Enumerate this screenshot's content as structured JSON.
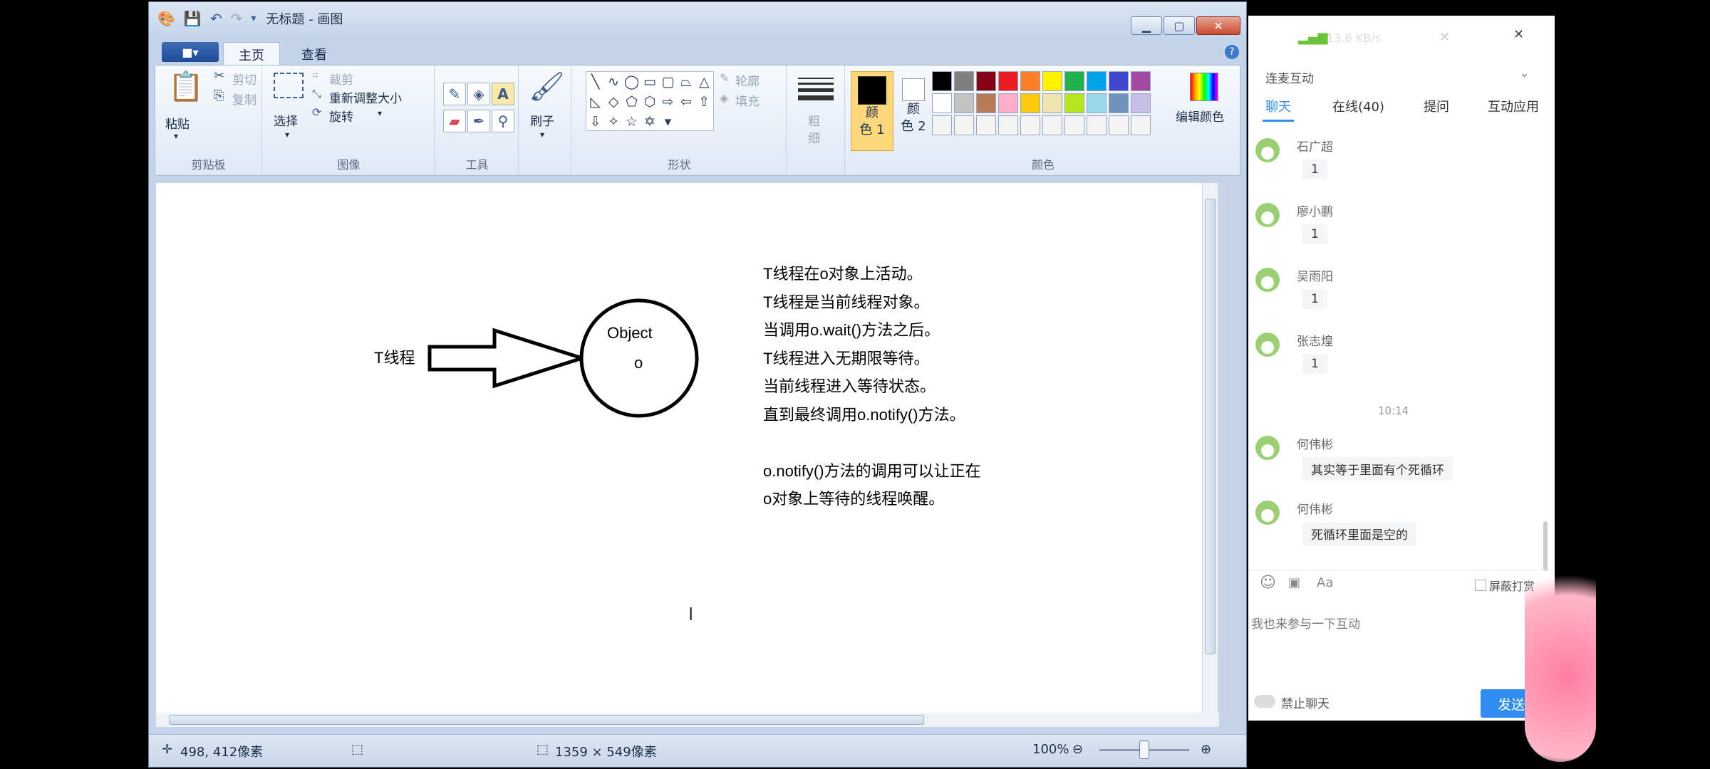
{
  "paint": {
    "window_title": "无标题 - 画图",
    "file_menu_icon": "■▾",
    "tabs": [
      "主页",
      "查看"
    ],
    "ribbon": {
      "clipboard": {
        "label": "剪贴板",
        "paste": "粘贴",
        "cut": "剪切",
        "copy": "复制"
      },
      "image": {
        "label": "图像",
        "select": "选择",
        "crop": "裁剪",
        "resize": "重新调整大小",
        "rotate": "旋转"
      },
      "tools": {
        "label": "工具"
      },
      "brushes": {
        "label": "刷子"
      },
      "shapes": {
        "label": "形状",
        "outline": "轮廓",
        "fill": "填充"
      },
      "size": {
        "label1": "粗",
        "label2": "细"
      },
      "colors": {
        "label": "颜色",
        "color1_a": "颜",
        "color1_b": "色 1",
        "color2_a": "颜",
        "color2_b": "色 2",
        "edit_colors": "编辑颜色",
        "color1": "#000000",
        "color2": "#ffffff"
      },
      "palette": [
        "#000000",
        "#7f7f7f",
        "#880015",
        "#ed1c24",
        "#ff7f27",
        "#fff200",
        "#22b14c",
        "#00a2e8",
        "#3f48cc",
        "#a349a4",
        "#ffffff",
        "#c3c3c3",
        "#b97a57",
        "#ffaec9",
        "#ffc90e",
        "#efe4b0",
        "#b5e61d",
        "#99d9ea",
        "#7092be",
        "#c8bfe7",
        "#f4f4f4",
        "#f4f4f4",
        "#f4f4f4",
        "#f4f4f4",
        "#f4f4f4",
        "#f4f4f4",
        "#f4f4f4",
        "#f4f4f4",
        "#f4f4f4",
        "#f4f4f4"
      ]
    },
    "canvas": {
      "arrow_label": "T线程",
      "circle_line1": "Object",
      "circle_line2": "o",
      "notes": [
        "T线程在o对象上活动。",
        "T线程是当前线程对象。",
        "当调用o.wait()方法之后。",
        "T线程进入无期限等待。",
        "当前线程进入等待状态。",
        "直到最终调用o.notify()方法。",
        "",
        "o.notify()方法的调用可以让正在",
        "o对象上等待的线程唤醒。"
      ]
    },
    "status": {
      "cursor_pos": "498, 412像素",
      "canvas_size": "1359 × 549像素",
      "zoom": "100%"
    }
  },
  "chat": {
    "net_speed": "13.6 KB/s",
    "section_title": "连麦互动",
    "tabs": [
      "聊天",
      "在线(40)",
      "提问",
      "互动应用"
    ],
    "messages": [
      {
        "user": "石广超",
        "text": "1"
      },
      {
        "user": "廖小鹏",
        "text": "1"
      },
      {
        "user": "吴雨阳",
        "text": "1"
      },
      {
        "user": "张志煌",
        "text": "1"
      }
    ],
    "time": "10:14",
    "messages2": [
      {
        "user": "何伟彬",
        "text": "其实等于里面有个死循环"
      },
      {
        "user": "何伟彬",
        "text": "死循环里面是空的"
      }
    ],
    "shield_label": "屏蔽打赏",
    "input_placeholder": "我也来参与一下互动",
    "mute_label": "禁止聊天",
    "send_label": "发送"
  }
}
